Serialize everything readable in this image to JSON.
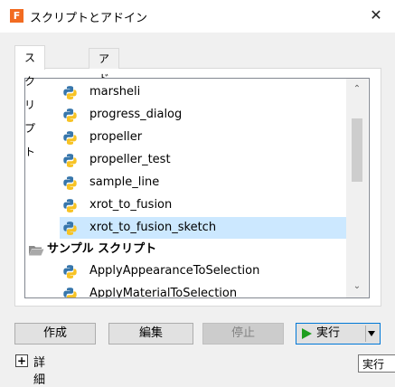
{
  "window": {
    "title": "スクリプトとアドイン",
    "app_icon_letter": "F",
    "close_glyph": "✕"
  },
  "tabs": [
    {
      "label": "スクリプト",
      "active": true
    },
    {
      "label": "アドイン",
      "active": false
    }
  ],
  "list": {
    "items": [
      {
        "label": "marsheli",
        "type": "script",
        "selected": false
      },
      {
        "label": "progress_dialog",
        "type": "script",
        "selected": false
      },
      {
        "label": "propeller",
        "type": "script",
        "selected": false
      },
      {
        "label": "propeller_test",
        "type": "script",
        "selected": false
      },
      {
        "label": "sample_line",
        "type": "script",
        "selected": false
      },
      {
        "label": "xrot_to_fusion",
        "type": "script",
        "selected": false
      },
      {
        "label": "xrot_to_fusion_sketch",
        "type": "script",
        "selected": true
      },
      {
        "label": "サンプル スクリプト",
        "type": "folder",
        "selected": false
      },
      {
        "label": "ApplyAppearanceToSelection",
        "type": "script",
        "selected": false
      },
      {
        "label": "ApplyMaterialToSelection",
        "type": "script",
        "selected": false
      }
    ],
    "scroll_up_glyph": "⌃",
    "scroll_down_glyph": "⌄"
  },
  "buttons": {
    "create": "作成",
    "edit": "編集",
    "stop": "停止",
    "run": "実行"
  },
  "details": {
    "label": "詳細",
    "toggle_glyph": "+"
  },
  "tooltip": {
    "text": "実行"
  },
  "colors": {
    "selection": "#cce8ff",
    "accent_border": "#0078d7",
    "run_arrow": "#1e9e1e",
    "app_icon": "#f26b21"
  }
}
